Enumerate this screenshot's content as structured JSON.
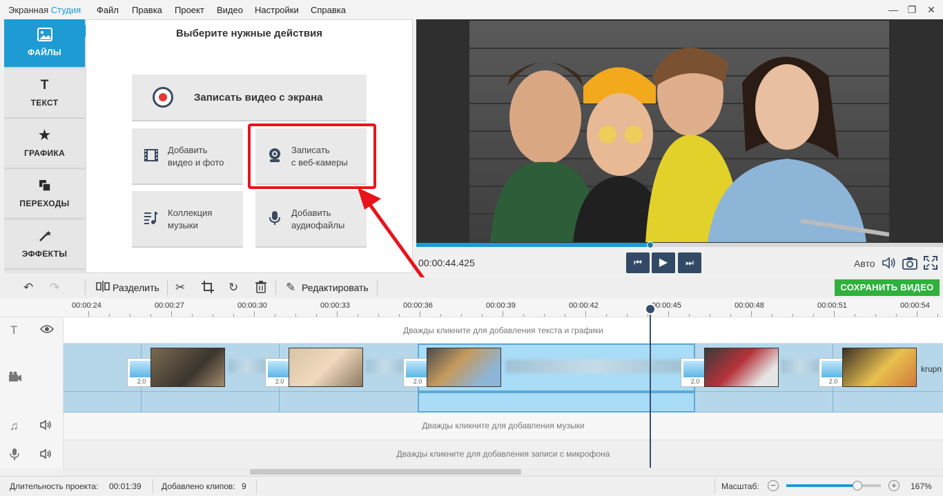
{
  "app": {
    "title_main": "Экранная ",
    "title_accent": "Студия",
    "menu": [
      "Файл",
      "Правка",
      "Проект",
      "Видео",
      "Настройки",
      "Справка"
    ]
  },
  "sidebar": {
    "tabs": [
      {
        "label": "ФАЙЛЫ",
        "icon": "image-icon",
        "active": true
      },
      {
        "label": "ТЕКСТ",
        "icon": "text-icon"
      },
      {
        "label": "ГРАФИКА",
        "icon": "star-icon"
      },
      {
        "label": "ПЕРЕХОДЫ",
        "icon": "transitions-icon"
      },
      {
        "label": "ЭФФЕКТЫ",
        "icon": "magic-wand-icon"
      }
    ]
  },
  "actions": {
    "title": "Выберите нужные действия",
    "record_screen": "Записать видео с экрана",
    "add_video_l1": "Добавить",
    "add_video_l2": "видео и фото",
    "webcam_l1": "Записать",
    "webcam_l2": "с веб-камеры",
    "music_l1": "Коллекция",
    "music_l2": "музыки",
    "audio_l1": "Добавить",
    "audio_l2": "аудиофайлы"
  },
  "player": {
    "timecode": "00:00:44.425",
    "progress": 0.444,
    "auto_label": "Авто"
  },
  "toolbar": {
    "split": "Разделить",
    "edit": "Редактировать",
    "save": "СОХРАНИТЬ ВИДЕО"
  },
  "timeline": {
    "ruler": [
      "00:00:24",
      "00:00:27",
      "00:00:30",
      "00:00:33",
      "00:00:36",
      "00:00:39",
      "00:00:42",
      "00:00:45",
      "00:00:48",
      "00:00:51",
      "00:00:54"
    ],
    "text_hint": "Дважды кликните для добавления текста и графики",
    "music_hint": "Дважды кликните для добавления музыки",
    "mic_hint": "Дважды кликните для добавления записи с микрофона",
    "transition_value": "2.0",
    "partial_clip_label": "krupn"
  },
  "status": {
    "duration_label": "Длительность проекта:",
    "duration_value": "00:01:39",
    "clips_label": "Добавлено клипов:",
    "clips_value": "9",
    "zoom_label": "Масштаб:",
    "zoom_value": "167%",
    "zoom_level": 0.75
  },
  "colors": {
    "accent": "#1e9bd3",
    "save_green": "#2fb13c",
    "highlight_red": "#e8141c"
  }
}
